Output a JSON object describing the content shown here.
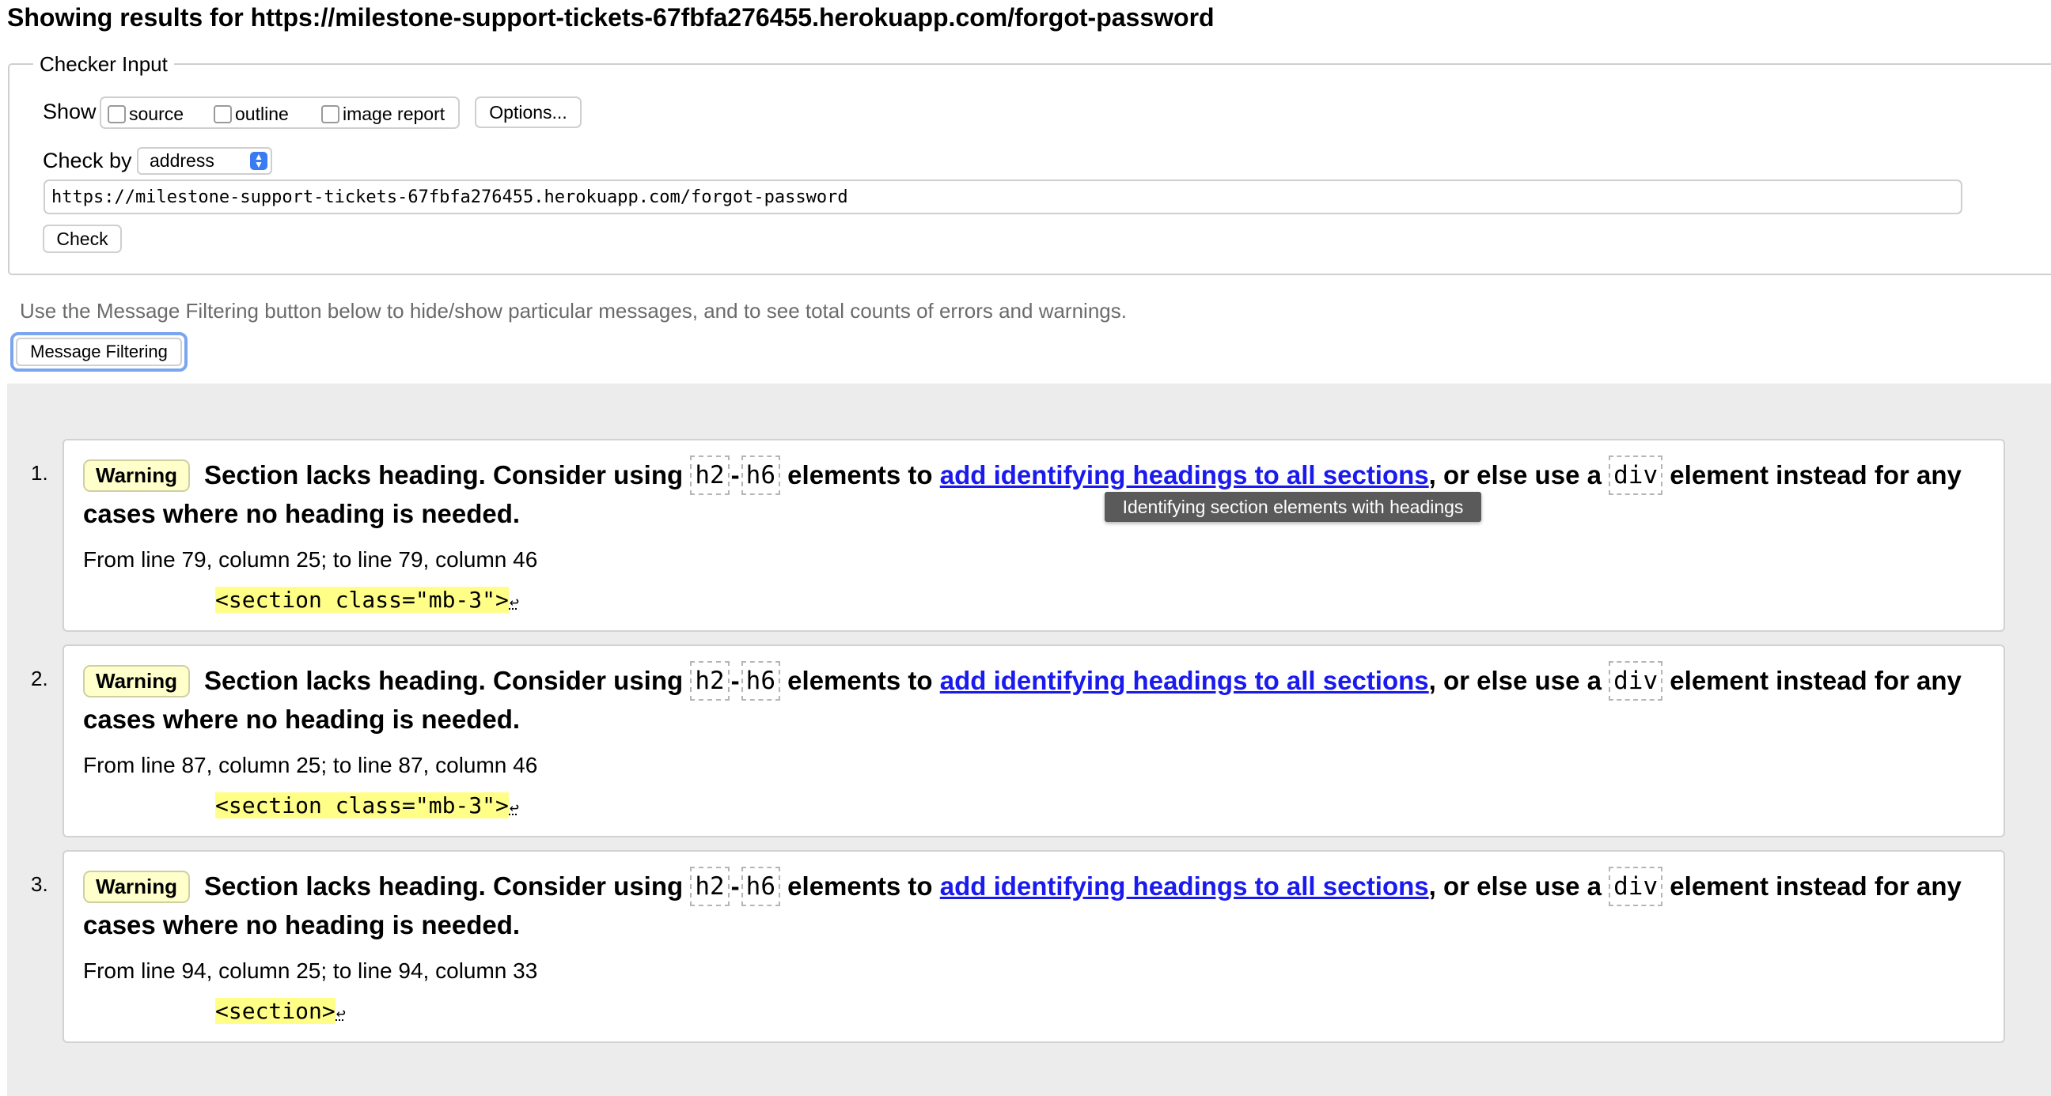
{
  "header": {
    "title": "Showing results for https://milestone-support-tickets-67fbfa276455.herokuapp.com/forgot-password"
  },
  "checker": {
    "legend": "Checker Input",
    "show_label": "Show",
    "show_options": [
      "source",
      "outline",
      "image report"
    ],
    "options_button": "Options...",
    "check_by_label": "Check by",
    "check_by_value": "address",
    "url_value": "https://milestone-support-tickets-67fbfa276455.herokuapp.com/forgot-password",
    "check_button": "Check"
  },
  "filtering": {
    "hint": "Use the Message Filtering button below to hide/show particular messages, and to see total counts of errors and warnings.",
    "button": "Message Filtering"
  },
  "tooltip": "Identifying section elements with headings",
  "messages": [
    {
      "number": "1.",
      "type": "Warning",
      "text_a": "Section lacks heading. Consider using",
      "code1": "h2",
      "dash": "-",
      "code2": "h6",
      "text_b": "elements to",
      "link": "add identifying headings to all sections",
      "text_c": ", or else use a",
      "code3": "div",
      "text_d": "element instead for any",
      "text_e": "cases where no heading is needed.",
      "location": "From line 79, column 25; to line 79, column 46",
      "extract": "<section class=\"mb-3\">",
      "extract_end": "↩"
    },
    {
      "number": "2.",
      "type": "Warning",
      "text_a": "Section lacks heading. Consider using",
      "code1": "h2",
      "dash": "-",
      "code2": "h6",
      "text_b": "elements to",
      "link": "add identifying headings to all sections",
      "text_c": ", or else use a",
      "code3": "div",
      "text_d": "element instead for any",
      "text_e": "cases where no heading is needed.",
      "location": "From line 87, column 25; to line 87, column 46",
      "extract": "<section class=\"mb-3\">",
      "extract_end": "↩"
    },
    {
      "number": "3.",
      "type": "Warning",
      "text_a": "Section lacks heading. Consider using",
      "code1": "h2",
      "dash": "-",
      "code2": "h6",
      "text_b": "elements to",
      "link": "add identifying headings to all sections",
      "text_c": ", or else use a",
      "code3": "div",
      "text_d": "element instead for any",
      "text_e": "cases where no heading is needed.",
      "location": "From line 94, column 25; to line 94, column 33",
      "extract": "<section>",
      "extract_end": "↩"
    }
  ]
}
